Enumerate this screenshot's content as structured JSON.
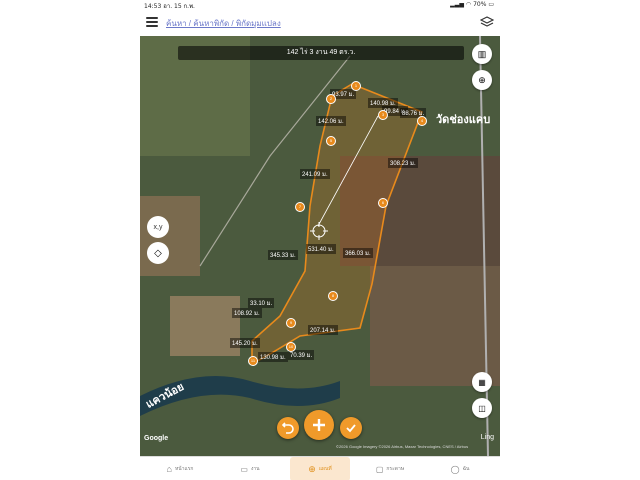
{
  "status_bar": {
    "time": "14:53",
    "date": "อา. 15 ก.พ.",
    "battery": "70%"
  },
  "header": {
    "breadcrumb": "ค้นหา / ค้นหาพิกัด / พิกัดมุมแปลง"
  },
  "map": {
    "area_readout": "142 ไร่ 3 งาน 49 ตร.ว.",
    "place_label": "วัดช่องแคบ",
    "river_label": "แควน้อย",
    "google_logo": "Google",
    "attribution": "©2026 Google Imagery ©2026 Airbus, Maxar Technologies, CNES / Airbus",
    "ling": "Ling",
    "xy_label": "x,y",
    "distances": [
      "93.97 ม.",
      "140.98 ม.",
      "99.84 ม.",
      "88.76 ม.",
      "142.06 ม.",
      "308.23 ม.",
      "241.09 ม.",
      "531.40 ม.",
      "345.33 ม.",
      "366.03 ม.",
      "33.10 ม.",
      "108.92 ม.",
      "207.14 ม.",
      "145.20 ม.",
      "130.98 ม.",
      "70.39 ม."
    ],
    "vertices": [
      "1",
      "2",
      "3",
      "4",
      "5",
      "6",
      "7",
      "8",
      "9",
      "10",
      "11",
      "12",
      "13",
      "14",
      "15",
      "16",
      "17",
      "18"
    ]
  },
  "actions": {
    "undo": "undo-icon",
    "add": "plus-icon",
    "confirm": "check-icon"
  },
  "nav": [
    {
      "label": "หน้าแรก",
      "icon": "home-icon"
    },
    {
      "label": "งาน",
      "icon": "briefcase-icon"
    },
    {
      "label": "แผนที่",
      "icon": "add-map-icon"
    },
    {
      "label": "กระดาษ",
      "icon": "message-icon"
    },
    {
      "label": "ฉัน",
      "icon": "person-icon"
    }
  ],
  "colors": {
    "accent": "#e88a1c",
    "nav_active_bg": "#fbe7cf",
    "breadcrumb": "#6b78c9"
  }
}
